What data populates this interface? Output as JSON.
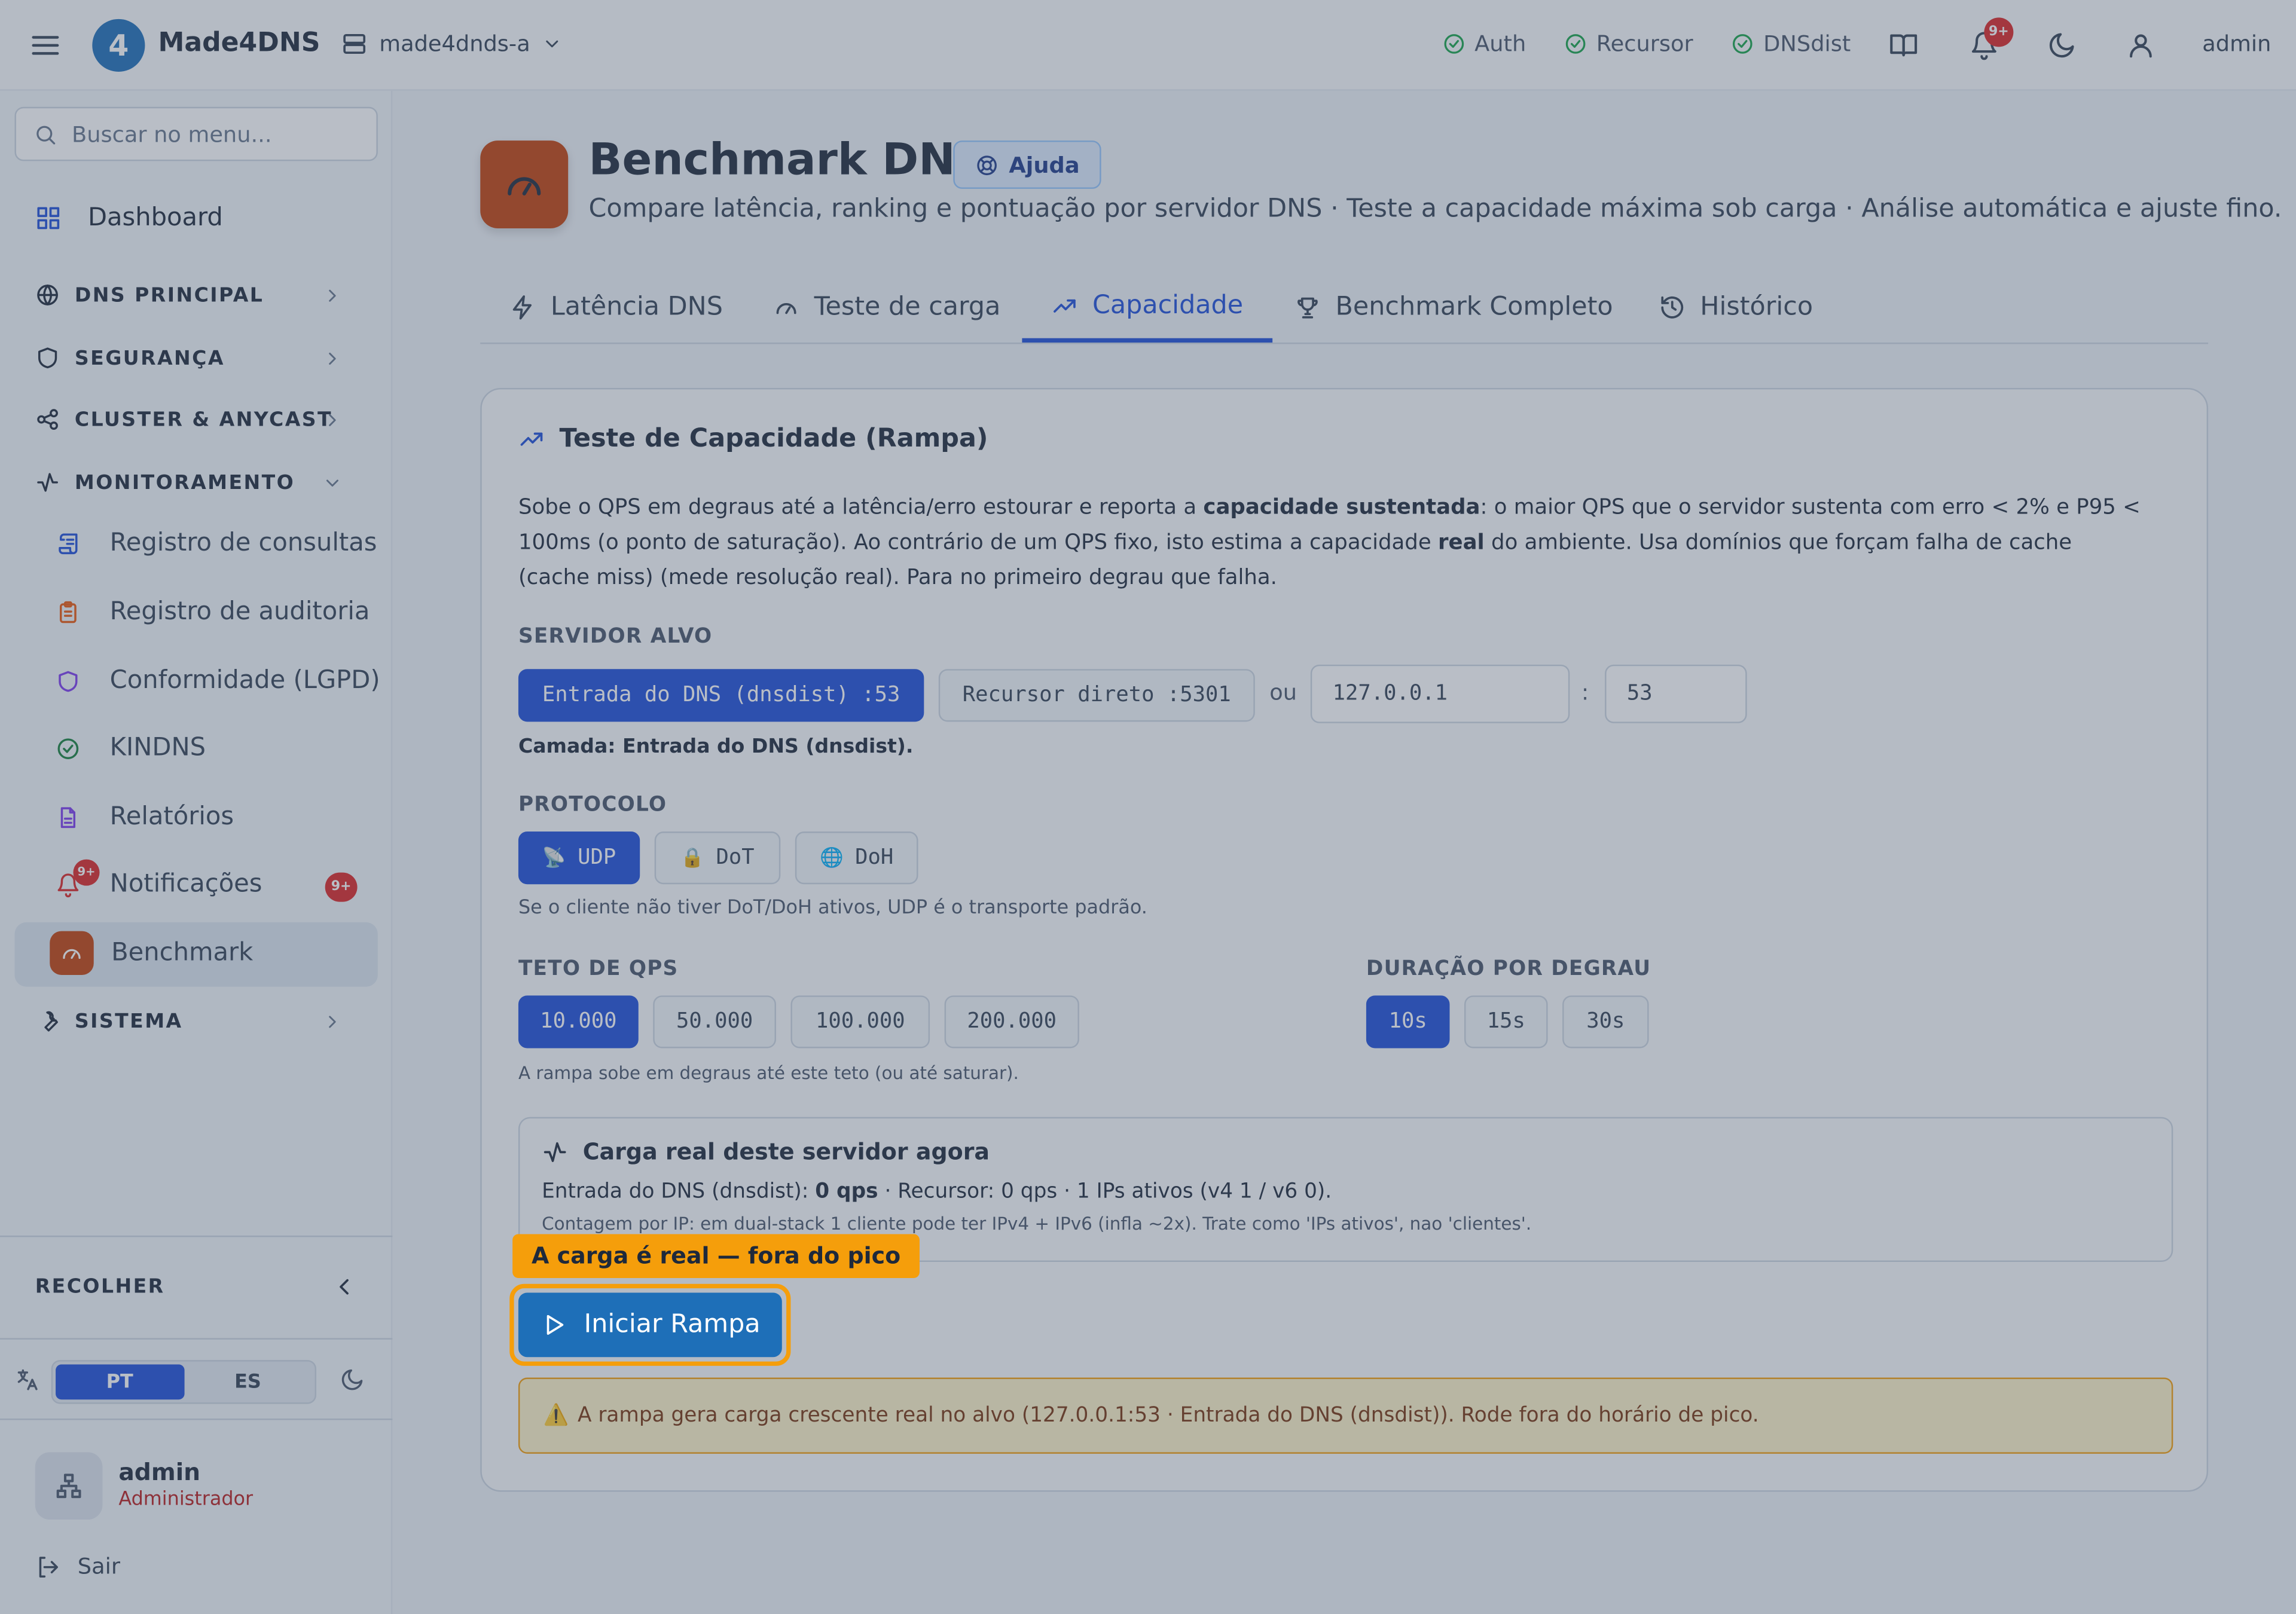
{
  "header": {
    "brand": "Made4DNS",
    "logo_glyph": "4",
    "server": "made4dnds-a",
    "services": [
      "Auth",
      "Recursor",
      "DNSdist"
    ],
    "notif_badge": "9+",
    "user": "admin"
  },
  "sidebar": {
    "search_placeholder": "Buscar no menu...",
    "dashboard": "Dashboard",
    "sections": {
      "dns": "DNS PRINCIPAL",
      "security": "SEGURANÇA",
      "cluster": "CLUSTER & ANYCAST",
      "monitor": "MONITORAMENTO",
      "system": "SISTEMA"
    },
    "monitor_items": [
      "Registro de consultas",
      "Registro de auditoria",
      "Conformidade (LGPD)",
      "KINDNS",
      "Relatórios",
      "Notificações",
      "Benchmark"
    ],
    "notif_badge": "9+",
    "collapse": "RECOLHER",
    "lang": [
      "PT",
      "ES"
    ],
    "profile_name": "admin",
    "profile_role": "Administrador",
    "logout": "Sair"
  },
  "page": {
    "title": "Benchmark DNS",
    "help": "Ajuda",
    "subtitle": "Compare latência, ranking e pontuação por servidor DNS · Teste a capacidade máxima sob carga · Análise automática e ajuste fino.",
    "tabs": [
      "Latência DNS",
      "Teste de carga",
      "Capacidade",
      "Benchmark Completo",
      "Histórico"
    ],
    "active_tab": "Capacidade"
  },
  "card": {
    "title": "Teste de Capacidade (Rampa)",
    "desc": {
      "p1": "Sobe o QPS em degraus até a latência/erro estourar e reporta a ",
      "b1": "capacidade sustentada",
      "p2": ": o maior QPS que o servidor sustenta com erro < 2% e P95 < 100ms (o ponto de saturação). Ao contrário de um QPS fixo, isto estima a capacidade ",
      "b2": "real",
      "p3": " do ambiente. Usa domínios que forçam falha de cache (cache miss) (mede resolução real). Para no primeiro degrau que falha."
    },
    "target_label": "SERVIDOR ALVO",
    "target_opts": [
      "Entrada do DNS (dnsdist) :53",
      "Recursor direto :5301"
    ],
    "or": "ou",
    "host": "127.0.0.1",
    "colon": ":",
    "port": "53",
    "layer": "Camada: Entrada do DNS (dnsdist).",
    "proto_label": "PROTOCOLO",
    "protocols": [
      "UDP",
      "DoT",
      "DoH"
    ],
    "proto_note": "Se o cliente não tiver DoT/DoH ativos, UDP é o transporte padrão.",
    "qps_label": "TETO DE QPS",
    "qps_opts": [
      "10.000",
      "50.000",
      "100.000",
      "200.000"
    ],
    "qps_note": "A rampa sobe em degraus até este teto (ou até saturar).",
    "dur_label": "DURAÇÃO POR DEGRAU",
    "dur_opts": [
      "10s",
      "15s",
      "30s"
    ],
    "load_title": "Carga real deste servidor agora",
    "load_p1": "Entrada do DNS (dnsdist): ",
    "load_qps": "0 qps",
    "load_p2": " · Recursor: 0 qps · 1 IPs ativos (v4 1 / v6 0).",
    "load_note": "Contagem por IP: em dual-stack 1 cliente pode ter IPv4 + IPv6 (infla ~2x). Trate como 'IPs ativos', nao 'clientes'.",
    "tooltip": "A carga é real — fora do pico",
    "start": "Iniciar Rampa",
    "warning": "A rampa gera carga crescente real no alvo (127.0.0.1:53 · Entrada do DNS (dnsdist)). Rode fora do horário de pico.",
    "warning_icon": "⚠️"
  },
  "colors": {
    "accent": "#1d4ed8",
    "brand_orange": "#c2410c",
    "highlight": "#f59e0b"
  }
}
